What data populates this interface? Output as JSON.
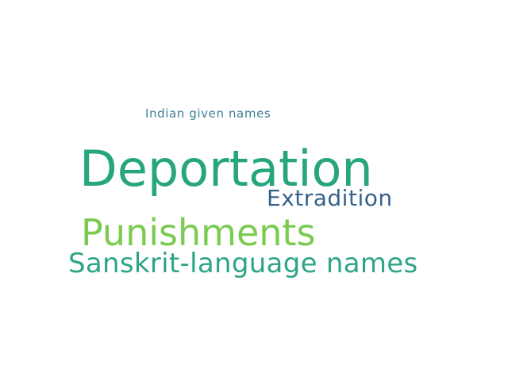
{
  "words": [
    {
      "text": "Indian given names",
      "color": "#3e7f96"
    },
    {
      "text": "Deportation",
      "color": "#27a57f"
    },
    {
      "text": "Extradition",
      "color": "#35628a"
    },
    {
      "text": "Punishments",
      "color": "#7acb4f"
    },
    {
      "text": "Sanskrit-language names",
      "color": "#2ea489"
    }
  ]
}
